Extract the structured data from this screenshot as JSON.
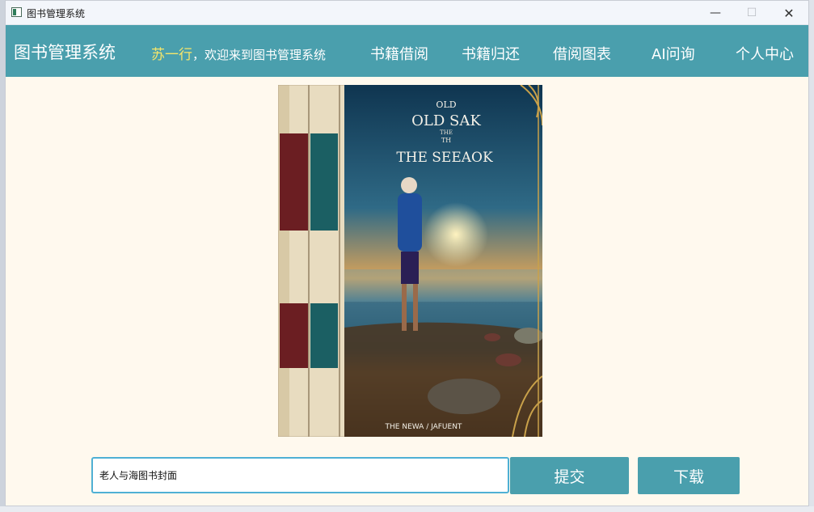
{
  "window": {
    "title": "图书管理系统",
    "controls": {
      "minimize": "—",
      "maximize": "☐",
      "close": "✕"
    }
  },
  "navbar": {
    "brand": "图书管理系统",
    "welcome_user": "苏一行",
    "welcome_text": "，欢迎来到图书管理系统",
    "items": [
      "书籍借阅",
      "书籍归还",
      "借阅图表",
      "AI问询",
      "个人中心"
    ]
  },
  "cover": {
    "title_lines": [
      "OLD",
      "OLD SAK",
      "THE",
      "TH",
      "THE SEEAOK"
    ],
    "footer": "THE NEWA / JAFUENT",
    "accent": "#c9a14a"
  },
  "form": {
    "input_value": "老人与海图书封面",
    "submit_label": "提交",
    "download_label": "下载"
  },
  "colors": {
    "nav": "#4a9fad",
    "background": "#fff9ee",
    "username": "#f6e66a",
    "input_border": "#4fb0d4"
  }
}
